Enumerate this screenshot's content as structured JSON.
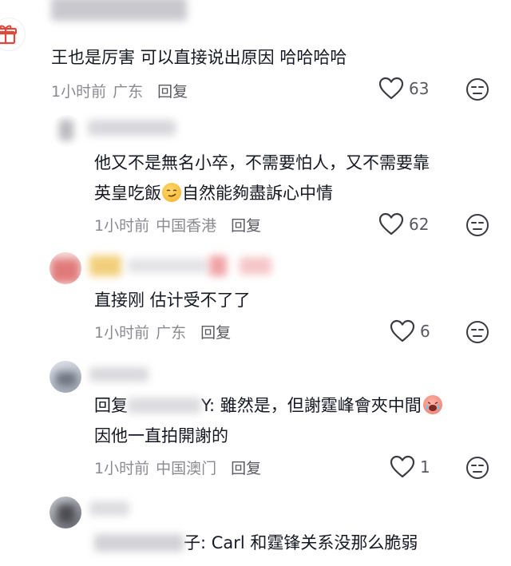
{
  "comments": [
    {
      "content": "王也是厉害 可以直接说出原因 哈哈哈哈",
      "time": "1小时前",
      "location": "广东",
      "reply": "回复",
      "likes": "63"
    },
    {
      "line1": "他又不是無名小卒，不需要怕人，又不需要靠",
      "line2a": "英皇吃飯",
      "line2b": "自然能夠盡訴心中情",
      "time": "1小时前",
      "location": "中国香港",
      "reply": "回复",
      "likes": "62"
    },
    {
      "content": "直接刚 估计受不了了",
      "time": "1小时前",
      "location": "广东",
      "reply": "回复",
      "likes": "6"
    },
    {
      "prefix": "回复",
      "suffix": "Y: 雖然是，但謝霆峰會夾中間",
      "line2": "因他一直拍開謝的",
      "time": "1小时前",
      "location": "中国澳门",
      "reply": "回复",
      "likes": "1"
    },
    {
      "suffix": "子: Carl 和霆锋关系没那么脆弱"
    }
  ],
  "icons": {
    "gift": "gift-icon",
    "like": "heart-outline-icon",
    "dislike": "dislike-face-icon",
    "smirk": "smirk-emoji",
    "cry": "crying-emoji"
  },
  "colors": {
    "text": "#161823",
    "meta": "#8a8b91",
    "reply": "#595a61"
  }
}
